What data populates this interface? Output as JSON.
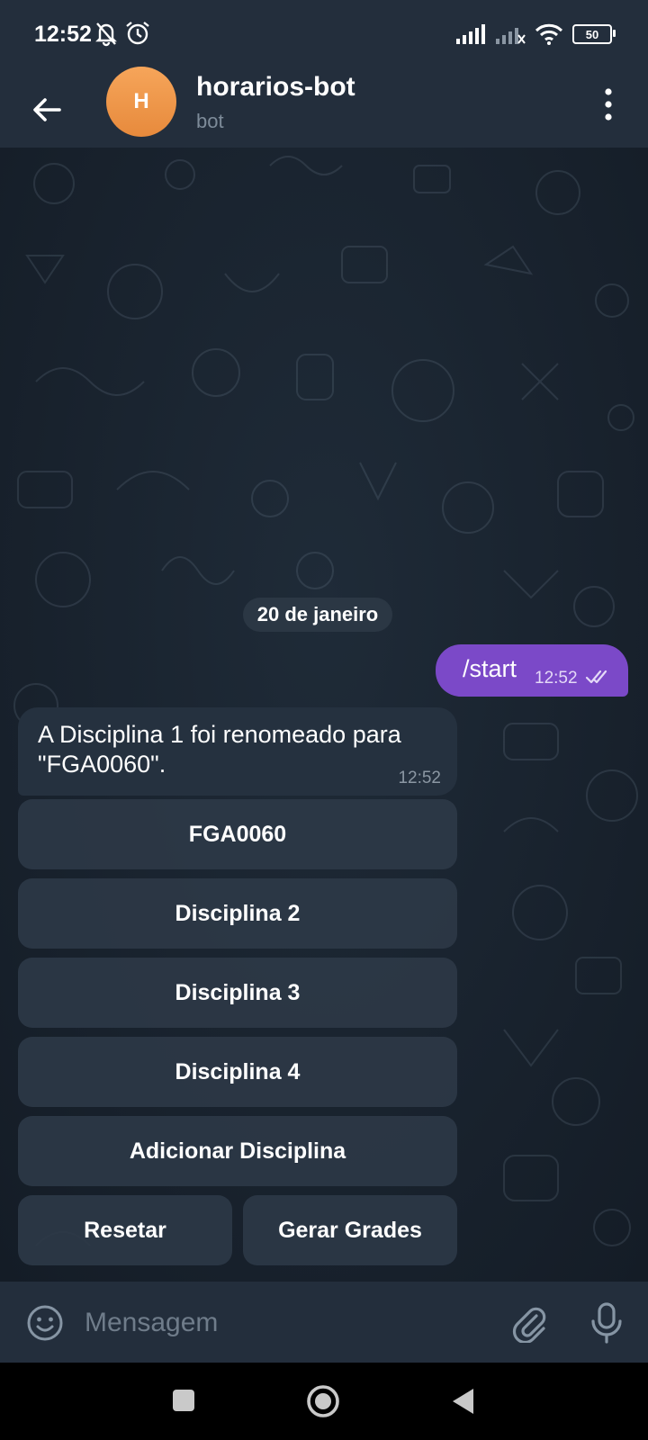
{
  "status_bar": {
    "time": "12:52",
    "icons": [
      "bell-off-icon",
      "alarm-icon"
    ],
    "right_icons": [
      "signal-icon",
      "signal-x-icon",
      "wifi-icon"
    ],
    "battery": "50"
  },
  "header": {
    "avatar_letter": "H",
    "title": "horarios-bot",
    "subtitle": "bot",
    "avatar_color": "#ef9a4a"
  },
  "chat": {
    "date": "20 de janeiro",
    "outgoing": {
      "text": "/start",
      "time": "12:52",
      "status": "read"
    },
    "incoming": {
      "text": "A Disciplina 1 foi renomeado para \"FGA0060\".",
      "time": "12:52"
    },
    "keyboard": [
      [
        "FGA0060"
      ],
      [
        "Disciplina 2"
      ],
      [
        "Disciplina 3"
      ],
      [
        "Disciplina 4"
      ],
      [
        "Adicionar Disciplina"
      ],
      [
        "Resetar",
        "Gerar Grades"
      ]
    ],
    "accent_color": "#7b49c8"
  },
  "input": {
    "placeholder": "Mensagem"
  }
}
